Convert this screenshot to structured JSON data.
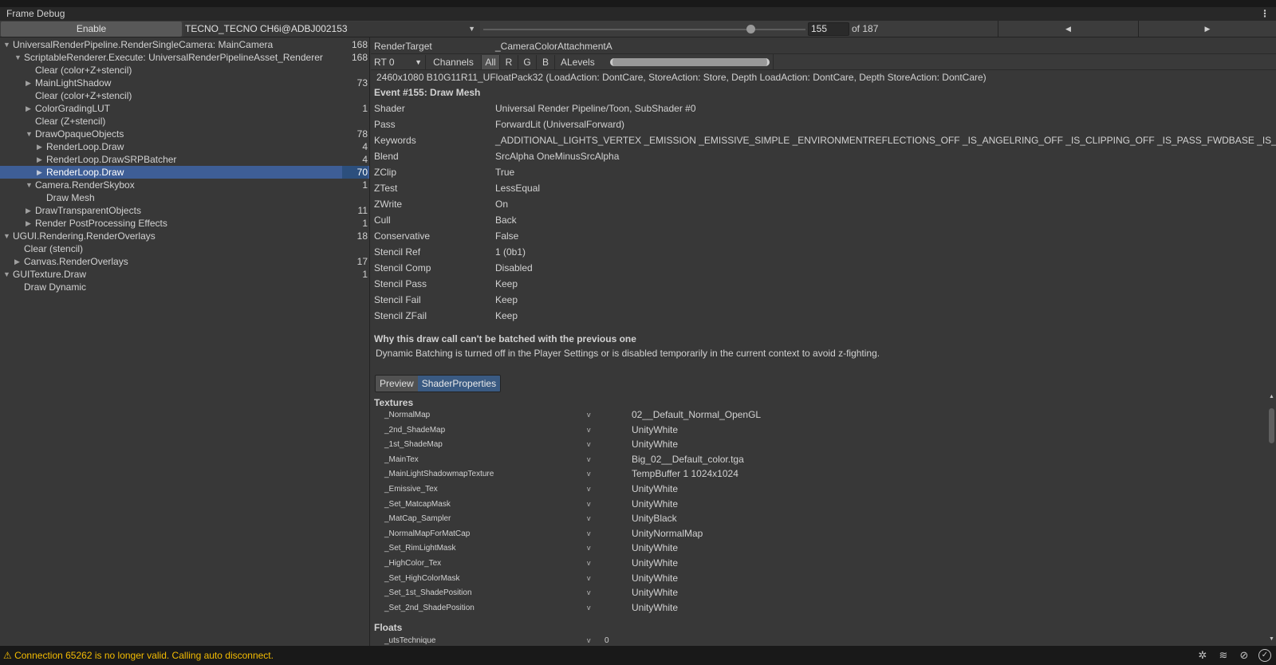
{
  "window": {
    "title": "Frame Debug",
    "menu_icon": "kebab-icon"
  },
  "toolbar": {
    "enable_label": "Enable",
    "device": "TECNO_TECNO CH6i@ADBJ002153",
    "event_index": "155",
    "event_total_label": "of 187",
    "event_fraction": 0.828
  },
  "tree": [
    {
      "label": "UniversalRenderPipeline.RenderSingleCamera: MainCamera",
      "count": "168",
      "level": 0,
      "arrow": "expanded"
    },
    {
      "label": "ScriptableRenderer.Execute: UniversalRenderPipelineAsset_Renderer",
      "count": "168",
      "level": 1,
      "arrow": "expanded"
    },
    {
      "label": "Clear (color+Z+stencil)",
      "count": "",
      "level": 2,
      "arrow": ""
    },
    {
      "label": "MainLightShadow",
      "count": "73",
      "level": 2,
      "arrow": "collapsed"
    },
    {
      "label": "Clear (color+Z+stencil)",
      "count": "",
      "level": 2,
      "arrow": ""
    },
    {
      "label": "ColorGradingLUT",
      "count": "1",
      "level": 2,
      "arrow": "collapsed"
    },
    {
      "label": "Clear (Z+stencil)",
      "count": "",
      "level": 2,
      "arrow": ""
    },
    {
      "label": "DrawOpaqueObjects",
      "count": "78",
      "level": 2,
      "arrow": "expanded"
    },
    {
      "label": "RenderLoop.Draw",
      "count": "4",
      "level": 3,
      "arrow": "collapsed"
    },
    {
      "label": "RenderLoop.DrawSRPBatcher",
      "count": "4",
      "level": 3,
      "arrow": "collapsed"
    },
    {
      "label": "RenderLoop.Draw",
      "count": "70",
      "level": 3,
      "arrow": "collapsed",
      "selected": true
    },
    {
      "label": "Camera.RenderSkybox",
      "count": "1",
      "level": 2,
      "arrow": "expanded"
    },
    {
      "label": "Draw Mesh",
      "count": "",
      "level": 3,
      "arrow": ""
    },
    {
      "label": "DrawTransparentObjects",
      "count": "11",
      "level": 2,
      "arrow": "collapsed"
    },
    {
      "label": "Render PostProcessing Effects",
      "count": "1",
      "level": 2,
      "arrow": "collapsed"
    },
    {
      "label": "UGUI.Rendering.RenderOverlays",
      "count": "18",
      "level": 0,
      "arrow": "expanded"
    },
    {
      "label": "Clear (stencil)",
      "count": "",
      "level": 1,
      "arrow": ""
    },
    {
      "label": "Canvas.RenderOverlays",
      "count": "17",
      "level": 1,
      "arrow": "collapsed"
    },
    {
      "label": "GUITexture.Draw",
      "count": "1",
      "level": 0,
      "arrow": "expanded"
    },
    {
      "label": "Draw Dynamic",
      "count": "",
      "level": 1,
      "arrow": ""
    }
  ],
  "render_target": {
    "label": "RenderTarget",
    "value": "_CameraColorAttachmentA",
    "rt_select": "RT 0",
    "channels_label": "Channels",
    "channels": [
      "All",
      "R",
      "G",
      "B",
      "A"
    ],
    "active_channel": "All",
    "levels_label": "Levels",
    "format": "2460x1080 B10G11R11_UFloatPack32 (LoadAction: DontCare, StoreAction: Store, Depth LoadAction: DontCare, Depth StoreAction: DontCare)"
  },
  "event": {
    "title": "Event #155: Draw Mesh",
    "properties": [
      {
        "label": "Shader",
        "value": "Universal Render Pipeline/Toon, SubShader #0"
      },
      {
        "label": "Pass",
        "value": "ForwardLit (UniversalForward)"
      },
      {
        "label": "Keywords",
        "value": "_ADDITIONAL_LIGHTS_VERTEX _EMISSION _EMISSIVE_SIMPLE _ENVIRONMENTREFLECTIONS_OFF _IS_ANGELRING_OFF _IS_CLIPPING_OFF _IS_PASS_FWDBASE _IS_TRANS"
      },
      {
        "label": "Blend",
        "value": "SrcAlpha OneMinusSrcAlpha"
      },
      {
        "label": "ZClip",
        "value": "True"
      },
      {
        "label": "ZTest",
        "value": "LessEqual"
      },
      {
        "label": "ZWrite",
        "value": "On"
      },
      {
        "label": "Cull",
        "value": "Back"
      },
      {
        "label": "Conservative",
        "value": "False"
      },
      {
        "label": "Stencil Ref",
        "value": "1 (0b1)"
      },
      {
        "label": "Stencil Comp",
        "value": "Disabled"
      },
      {
        "label": "Stencil Pass",
        "value": "Keep"
      },
      {
        "label": "Stencil Fail",
        "value": "Keep"
      },
      {
        "label": "Stencil ZFail",
        "value": "Keep"
      }
    ],
    "batch_title": "Why this draw call can't be batched with the previous one",
    "batch_reason": "Dynamic Batching is turned off in the Player Settings or is disabled temporarily in the current context to avoid z-fighting."
  },
  "tabs": [
    {
      "label": "Preview",
      "active": false
    },
    {
      "label": "ShaderProperties",
      "active": true
    }
  ],
  "shader_properties": {
    "textures_header": "Textures",
    "textures": [
      {
        "name": "_NormalMap",
        "stage": "v",
        "value": "02__Default_Normal_OpenGL"
      },
      {
        "name": "_2nd_ShadeMap",
        "stage": "v",
        "value": "UnityWhite"
      },
      {
        "name": "_1st_ShadeMap",
        "stage": "v",
        "value": "UnityWhite"
      },
      {
        "name": "_MainTex",
        "stage": "v",
        "value": "Big_02__Default_color.tga"
      },
      {
        "name": "_MainLightShadowmapTexture",
        "stage": "v",
        "value": "TempBuffer 1 1024x1024"
      },
      {
        "name": "_Emissive_Tex",
        "stage": "v",
        "value": "UnityWhite"
      },
      {
        "name": "_Set_MatcapMask",
        "stage": "v",
        "value": "UnityWhite"
      },
      {
        "name": "_MatCap_Sampler",
        "stage": "v",
        "value": "UnityBlack"
      },
      {
        "name": "_NormalMapForMatCap",
        "stage": "v",
        "value": "UnityNormalMap"
      },
      {
        "name": "_Set_RimLightMask",
        "stage": "v",
        "value": "UnityWhite"
      },
      {
        "name": "_HighColor_Tex",
        "stage": "v",
        "value": "UnityWhite"
      },
      {
        "name": "_Set_HighColorMask",
        "stage": "v",
        "value": "UnityWhite"
      },
      {
        "name": "_Set_1st_ShadePosition",
        "stage": "v",
        "value": "UnityWhite"
      },
      {
        "name": "_Set_2nd_ShadePosition",
        "stage": "v",
        "value": "UnityWhite"
      }
    ],
    "floats_header": "Floats",
    "floats": [
      {
        "name": "_utsTechnique",
        "stage": "v",
        "value": "0"
      }
    ]
  },
  "status": {
    "message": "Connection 65262 is no longer valid. Calling auto disconnect.",
    "color": "#f4bc02",
    "icons": [
      "debug-off-icon",
      "database-off-icon",
      "network-off-icon",
      "check-circle-icon"
    ]
  },
  "colors": {
    "selection": "#3e5e96",
    "active_tab": "#3a5a82",
    "background": "#383838"
  }
}
